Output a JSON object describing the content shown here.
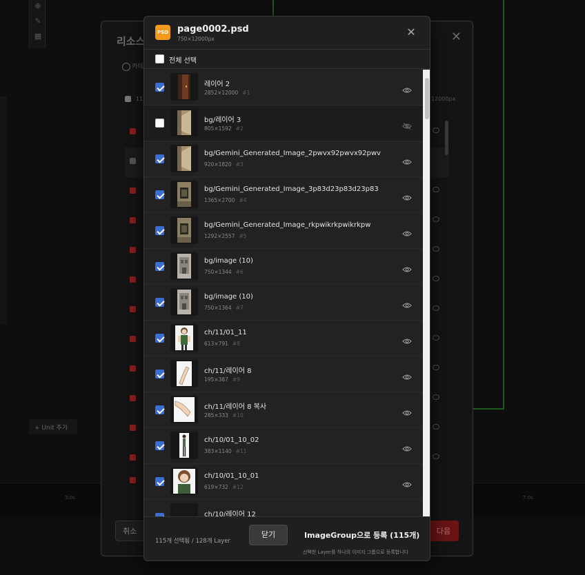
{
  "background": {
    "ruler_left": "3.0s",
    "ruler_right": "7.0s",
    "unit_add_label": "+ Unit 추가"
  },
  "under_modal": {
    "title": "리소스",
    "tab_label": "카테",
    "count_label": "115",
    "px_label": "12000px",
    "cancel_label": "취소",
    "next_label": "다음"
  },
  "dialog": {
    "file_icon": "PSD",
    "file_name": "page0002.psd",
    "file_size": "750×12000px",
    "close_icon": "close-icon",
    "select_all_label": "전체 선택",
    "select_all_checked": false
  },
  "layers": [
    {
      "name": "레이어 2",
      "size": "2852×12000",
      "index": "#1",
      "checked": true,
      "visible": true,
      "thumb": "door"
    },
    {
      "name": "bg/레이어 3",
      "size": "805×1592",
      "index": "#2",
      "checked": false,
      "visible": false,
      "thumb": "wall"
    },
    {
      "name": "bg/Gemini_Generated_Image_2pwvx92pwvx92pwv",
      "size": "920×1820",
      "index": "#3",
      "checked": true,
      "visible": true,
      "thumb": "wall"
    },
    {
      "name": "bg/Gemini_Generated_Image_3p83d23p83d23p83",
      "size": "1365×2700",
      "index": "#4",
      "checked": true,
      "visible": true,
      "thumb": "room"
    },
    {
      "name": "bg/Gemini_Generated_Image_rkpwikrkpwikrkpw",
      "size": "1292×2557",
      "index": "#5",
      "checked": true,
      "visible": true,
      "thumb": "room"
    },
    {
      "name": "bg/image (10)",
      "size": "750×1344",
      "index": "#6",
      "checked": true,
      "visible": true,
      "thumb": "building"
    },
    {
      "name": "bg/image (10)",
      "size": "750×1364",
      "index": "#7",
      "checked": true,
      "visible": true,
      "thumb": "building"
    },
    {
      "name": "ch/11/01_11",
      "size": "613×791",
      "index": "#8",
      "checked": true,
      "visible": true,
      "thumb": "char"
    },
    {
      "name": "ch/11/레이어 8",
      "size": "195×387",
      "index": "#9",
      "checked": true,
      "visible": true,
      "thumb": "arm"
    },
    {
      "name": "ch/11/레이어 8 복사",
      "size": "285×333",
      "index": "#10",
      "checked": true,
      "visible": true,
      "thumb": "arm2"
    },
    {
      "name": "ch/10/01_10_02",
      "size": "383×1140",
      "index": "#11",
      "checked": true,
      "visible": true,
      "thumb": "figure"
    },
    {
      "name": "ch/10/01_10_01",
      "size": "619×732",
      "index": "#12",
      "checked": true,
      "visible": true,
      "thumb": "girl"
    },
    {
      "name": "ch/10/레이어 12",
      "size": "",
      "index": "",
      "checked": true,
      "visible": true,
      "thumb": "dark"
    }
  ],
  "footer": {
    "count_text": "115개 선택됨 / 128개 Layer",
    "close_label": "닫기",
    "register_label": "ImageGroup으로 등록 (115개)",
    "hint": "선택한 Layer를 하나의 이미지 그룹으로 등록합니다"
  },
  "colors": {
    "accent_check": "#3b6fd4",
    "psd_icon": "#f39a1e",
    "danger": "#8a1f1f"
  }
}
